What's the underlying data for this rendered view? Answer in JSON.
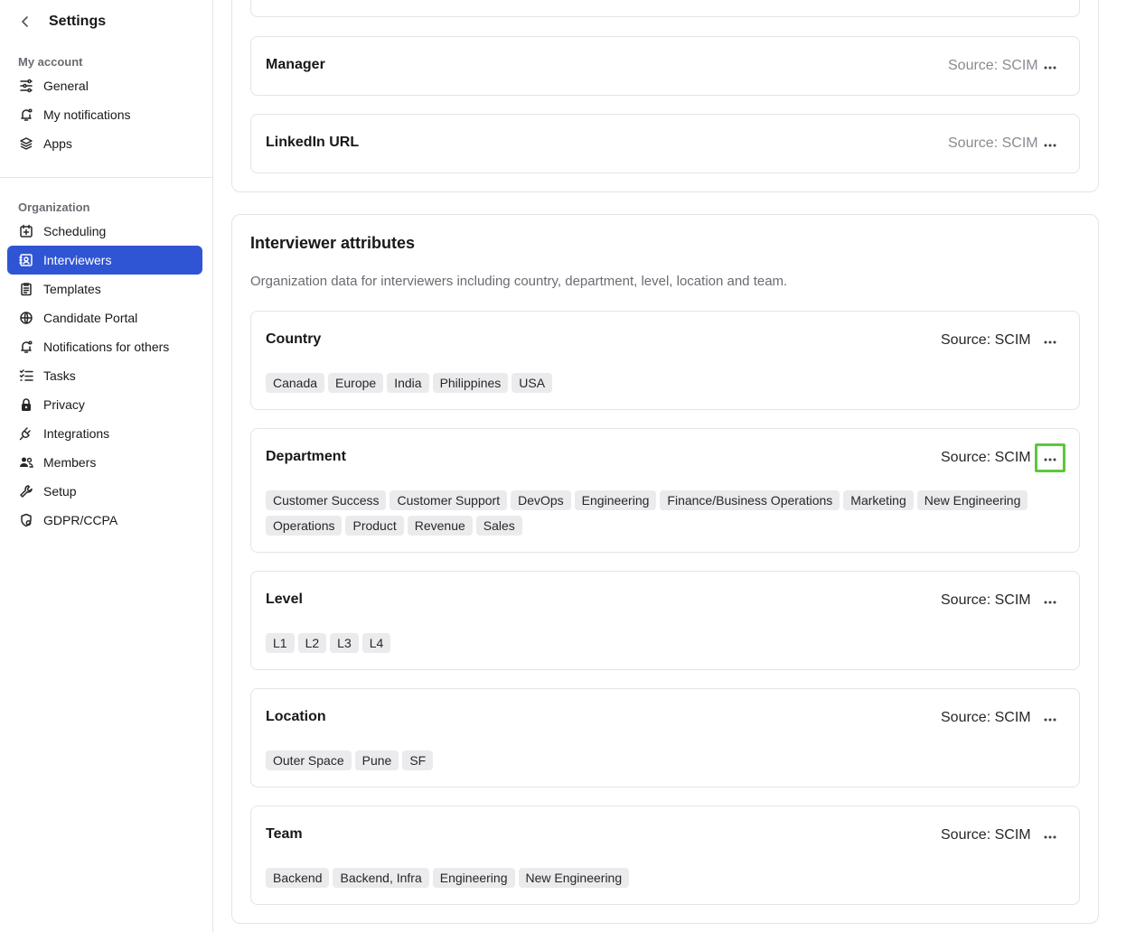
{
  "sidebar": {
    "title": "Settings",
    "my_account_label": "My account",
    "my_account_items": [
      {
        "label": "General",
        "icon": "sliders-icon"
      },
      {
        "label": "My notifications",
        "icon": "bell-icon"
      },
      {
        "label": "Apps",
        "icon": "layers-icon"
      }
    ],
    "organization_label": "Organization",
    "organization_items": [
      {
        "label": "Scheduling",
        "icon": "calendar-plus-icon"
      },
      {
        "label": "Interviewers",
        "icon": "contact-card-icon",
        "active": true
      },
      {
        "label": "Templates",
        "icon": "clipboard-list-icon"
      },
      {
        "label": "Candidate Portal",
        "icon": "globe-icon"
      },
      {
        "label": "Notifications for others",
        "icon": "bell-dot-icon"
      },
      {
        "label": "Tasks",
        "icon": "checklist-icon"
      },
      {
        "label": "Privacy",
        "icon": "lock-icon"
      },
      {
        "label": "Integrations",
        "icon": "plug-icon"
      },
      {
        "label": "Members",
        "icon": "users-icon"
      },
      {
        "label": "Setup",
        "icon": "wrench-icon"
      },
      {
        "label": "GDPR/CCPA",
        "icon": "shield-gear-icon"
      }
    ]
  },
  "top_cards": [
    {
      "title": "Manager",
      "source": "Source: SCIM"
    },
    {
      "title": "LinkedIn URL",
      "source": "Source: SCIM"
    }
  ],
  "interviewer_attributes": {
    "title": "Interviewer attributes",
    "description": "Organization data for interviewers including country, department, level, location and team.",
    "cards": [
      {
        "title": "Country",
        "source": "Source: SCIM",
        "tags": [
          "Canada",
          "Europe",
          "India",
          "Philippines",
          "USA"
        ]
      },
      {
        "title": "Department",
        "source": "Source: SCIM",
        "tags": [
          "Customer Success",
          "Customer Support",
          "DevOps",
          "Engineering",
          "Finance/Business Operations",
          "Marketing",
          "New Engineering",
          "Operations",
          "Product",
          "Revenue",
          "Sales"
        ]
      },
      {
        "title": "Level",
        "source": "Source: SCIM",
        "tags": [
          "L1",
          "L2",
          "L3",
          "L4"
        ]
      },
      {
        "title": "Location",
        "source": "Source: SCIM",
        "tags": [
          "Outer Space",
          "Pune",
          "SF"
        ]
      },
      {
        "title": "Team",
        "source": "Source: SCIM",
        "tags": [
          "Backend",
          "Backend, Infra",
          "Engineering",
          "New Engineering"
        ]
      }
    ]
  },
  "colors": {
    "accent": "#2f55d4",
    "focus_ring": "#5ac83c",
    "tag_bg": "#ebebed"
  }
}
